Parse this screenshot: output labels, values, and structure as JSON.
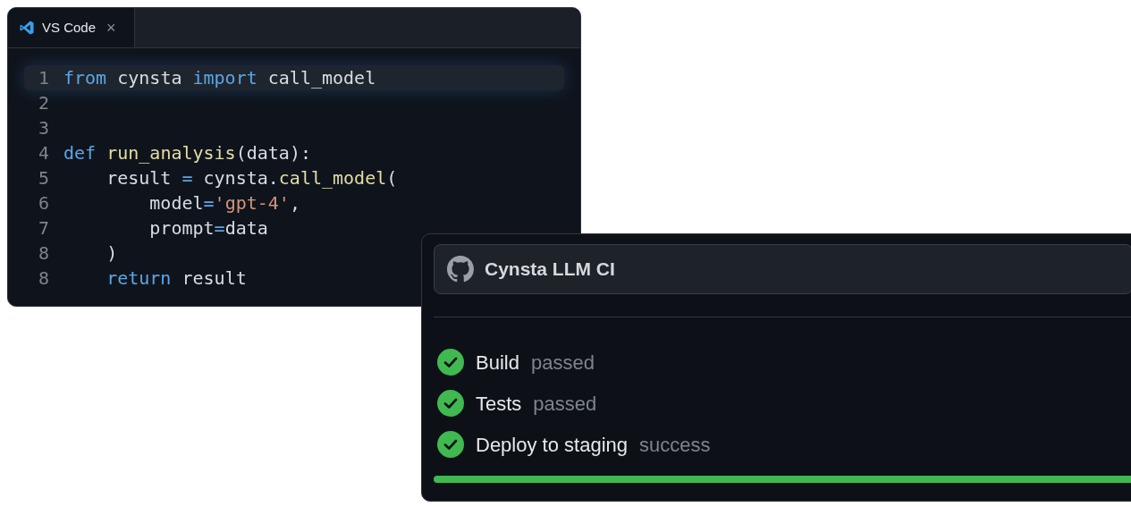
{
  "editor": {
    "tab": {
      "label": "VS Code",
      "close": "×",
      "selected": true
    },
    "lines": [
      {
        "number": "1",
        "highlighted": true,
        "tokens": [
          {
            "kind": "keyword",
            "text": "from"
          },
          {
            "kind": "plain",
            "text": " cynsta "
          },
          {
            "kind": "keyword",
            "text": "import"
          },
          {
            "kind": "plain",
            "text": " call_model"
          }
        ]
      },
      {
        "number": "2",
        "highlighted": false
      },
      {
        "number": "3",
        "highlighted": false
      },
      {
        "number": "4",
        "highlighted": false,
        "tokens": [
          {
            "kind": "keyword",
            "text": "def "
          },
          {
            "kind": "function",
            "text": "run_analysis"
          },
          {
            "kind": "plain",
            "text": "(data):"
          }
        ]
      },
      {
        "number": "5",
        "highlighted": false,
        "tokens": [
          {
            "kind": "plain",
            "text": "    result "
          },
          {
            "kind": "operator",
            "text": "="
          },
          {
            "kind": "plain",
            "text": " cynsta."
          },
          {
            "kind": "function",
            "text": "call_model"
          },
          {
            "kind": "plain",
            "text": "("
          }
        ]
      },
      {
        "number": "6",
        "highlighted": false,
        "tokens": [
          {
            "kind": "plain",
            "text": "        model"
          },
          {
            "kind": "operator",
            "text": "="
          },
          {
            "kind": "string",
            "text": "'gpt-4'"
          },
          {
            "kind": "plain",
            "text": ","
          }
        ]
      },
      {
        "number": "7",
        "highlighted": false,
        "tokens": [
          {
            "kind": "plain",
            "text": "        prompt"
          },
          {
            "kind": "operator",
            "text": "="
          },
          {
            "kind": "plain",
            "text": "data"
          }
        ]
      },
      {
        "number": "8",
        "highlighted": false,
        "tokens": [
          {
            "kind": "plain",
            "text": "    )"
          }
        ]
      },
      {
        "number": "8",
        "highlighted": false,
        "tokens": [
          {
            "kind": "keyword",
            "text": "    return"
          },
          {
            "kind": "plain",
            "text": " result"
          }
        ]
      }
    ]
  },
  "ci": {
    "title": "Cynsta LLM CI",
    "steps": [
      {
        "name": "Build",
        "status": "passed",
        "passed": true
      },
      {
        "name": "Tests",
        "status": "passed",
        "passed": true
      },
      {
        "name": "Deploy to staging",
        "status": "success",
        "passed": true
      }
    ],
    "progress": {
      "level": 1
    }
  }
}
